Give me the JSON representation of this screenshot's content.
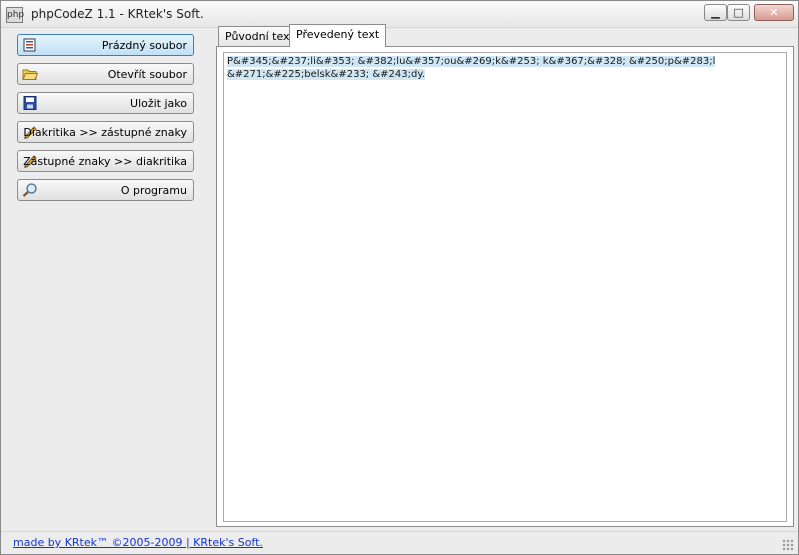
{
  "window": {
    "icon_text": "php",
    "title": "phpCodeZ 1.1 - KRtek's Soft.",
    "controls": {
      "minimize": "—",
      "maximize": "□",
      "close": "X"
    }
  },
  "sidebar": {
    "buttons": [
      {
        "label": "Prázdný soubor",
        "icon": "new-file-icon",
        "active": true
      },
      {
        "label": "Otevřít soubor",
        "icon": "open-folder-icon",
        "active": false
      },
      {
        "label": "Uložit jako",
        "icon": "save-disk-icon",
        "active": false
      },
      {
        "label": "Diakritika >> zástupné znaky",
        "icon": "pencil-icon",
        "active": false
      },
      {
        "label": "Zástupné znaky >> diakritika",
        "icon": "pencil-icon",
        "active": false
      },
      {
        "label": "O programu",
        "icon": "magnifier-icon",
        "active": false
      }
    ]
  },
  "tabs": {
    "items": [
      {
        "label": "Původní text"
      },
      {
        "label": "Převedený text"
      }
    ],
    "selected_index": 1
  },
  "editor": {
    "lines": [
      "P&#345;&#237;li&#353; &#382;lu&#357;ou&#269;k&#253; k&#367;&#328; &#250;p&#283;l",
      "&#271;&#225;belsk&#233; &#243;dy."
    ]
  },
  "status": {
    "link_text": "made by KRtek™ ©2005-2009 | KRtek's Soft."
  },
  "colors": {
    "active_button": "#bfe1f7",
    "selection": "#cfe6f5",
    "link": "#1436c8"
  }
}
